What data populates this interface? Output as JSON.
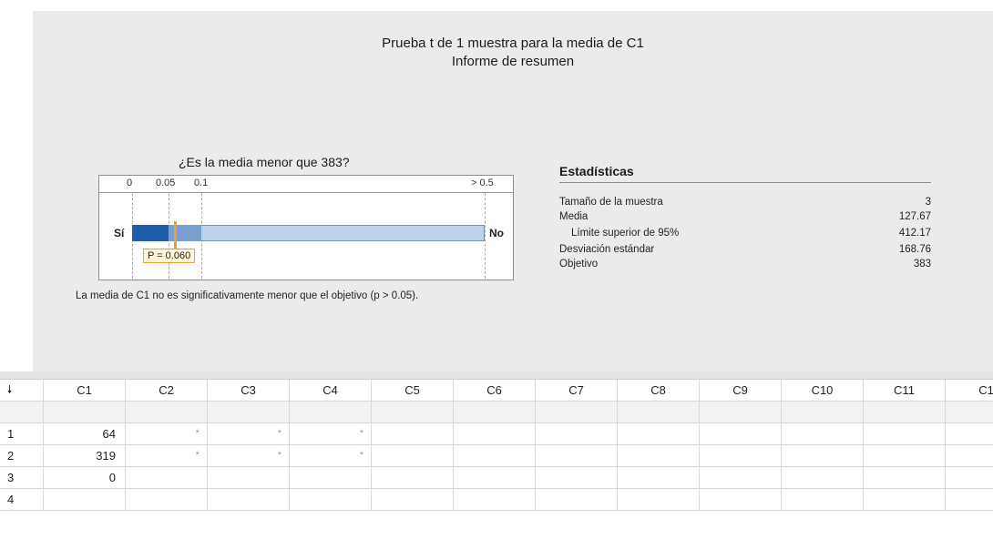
{
  "report": {
    "title": "Prueba t de 1 muestra para la media de C1",
    "subtitle": "Informe de resumen",
    "question": "¿Es la media menor que 383?",
    "scale_ticks": [
      "0",
      "0.05",
      "0.1",
      "> 0.5"
    ],
    "yes_label": "Sí",
    "no_label": "No",
    "p_label": "P = 0.060",
    "p_value": 0.06,
    "conclusion": "La media de C1 no es significativamente menor que el objetivo (p > 0.05).",
    "colors": {
      "bar_dark": "#1f5ca9",
      "bar_mid": "#7b9fd0",
      "bar_light": "#bcd1ea",
      "p_marker": "#f0a030"
    }
  },
  "stats": {
    "title": "Estadísticas",
    "rows": [
      {
        "label": "Tamaño de la muestra",
        "value": "3"
      },
      {
        "label": "Media",
        "value": "127.67"
      },
      {
        "label": "Límite superior de 95%",
        "value": "412.17"
      },
      {
        "label": "Desviación estándar",
        "value": "168.76"
      },
      {
        "label": "Objetivo",
        "value": "383"
      }
    ]
  },
  "worksheet": {
    "corner_icon": "down-arrow-icon",
    "corner_glyph": "🠗",
    "columns": [
      "C1",
      "C2",
      "C3",
      "C4",
      "C5",
      "C6",
      "C7",
      "C8",
      "C9",
      "C10",
      "C11",
      "C1"
    ],
    "row_numbers": [
      "1",
      "2",
      "3",
      "4"
    ],
    "rows": [
      [
        "64",
        "*",
        "*",
        "*",
        "",
        "",
        "",
        "",
        "",
        "",
        "",
        ""
      ],
      [
        "319",
        "*",
        "*",
        "*",
        "",
        "",
        "",
        "",
        "",
        "",
        "",
        ""
      ],
      [
        "0",
        "",
        "",
        "",
        "",
        "",
        "",
        "",
        "",
        "",
        "",
        ""
      ],
      [
        "",
        "",
        "",
        "",
        "",
        "",
        "",
        "",
        "",
        "",
        "",
        ""
      ]
    ]
  }
}
